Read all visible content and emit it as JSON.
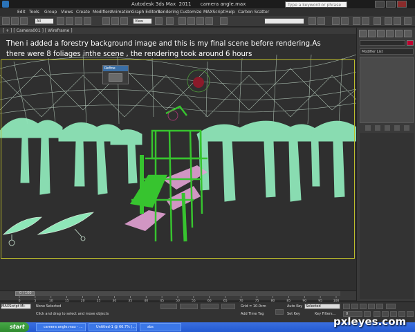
{
  "window": {
    "title": "Autodesk 3ds Max  2011      camera angle.max",
    "search_placeholder": "Type a keyword or phrase"
  },
  "menu": [
    "Edit",
    "Tools",
    "Group",
    "Views",
    "Create",
    "Modifiers",
    "Animation",
    "Graph Editors",
    "Rendering",
    "Customize",
    "MAXScript",
    "Help",
    "Carbon Scatter"
  ],
  "toolbar": {
    "filter_select": "All",
    "coord_select": "View"
  },
  "viewport": {
    "label": "[ + ] [ Camera001 ] [ Wireframe ]",
    "caption_line1": "Then i added a forestry background image and this is my final scene before rendering.As",
    "caption_line2": "there were 8 foliages inthe scene , the rendering took around 6 hours",
    "float_panel_title": "Refine"
  },
  "command_panel": {
    "modifier_list": "Modifier List"
  },
  "timeline": {
    "slider_label": "0 / 100",
    "ticks": [
      "0",
      "5",
      "10",
      "15",
      "20",
      "25",
      "30",
      "35",
      "40",
      "45",
      "50",
      "55",
      "60",
      "65",
      "70",
      "75",
      "80",
      "85",
      "90",
      "95",
      "100"
    ]
  },
  "status": {
    "maxscript": "MAXScript Mi:",
    "selection": "None Selected",
    "prompt": "Click and drag to select and move objects",
    "grid": "Grid = 10.0cm",
    "add_time_tag": "Add Time Tag",
    "auto_key": "Auto Key",
    "auto_key_value": "Selected",
    "set_key": "Set Key",
    "key_filters": "Key Filters...",
    "frame_value": "0"
  },
  "taskbar": {
    "start": "start",
    "items": [
      "camera angle.max - ...",
      "Untitled-1 @ 66.7% (...",
      "abs"
    ]
  },
  "watermark": "pxleyes.com",
  "colors": {
    "viewport_bg": "#2f2f2f",
    "trees": "#8ee6b8",
    "structure": "#37c42f",
    "pink_mesh": "#e3a2d4",
    "frame": "#bdbd2c",
    "sky_mesh": "#cfe8d6"
  }
}
